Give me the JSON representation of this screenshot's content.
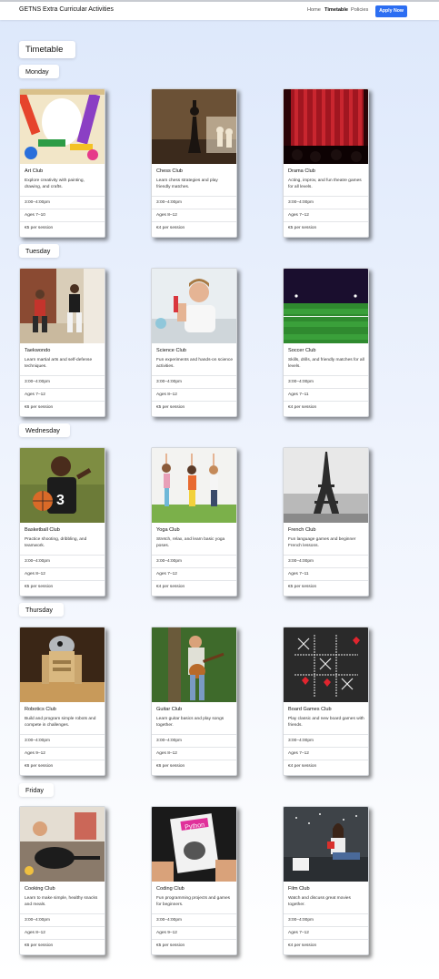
{
  "header": {
    "brand": "GETNS Extra Curricular Activities",
    "nav": [
      {
        "label": "Home",
        "active": false
      },
      {
        "label": "Timetable",
        "active": true
      },
      {
        "label": "Policies",
        "active": false
      }
    ],
    "apply_label": "Apply Now",
    "accent": "#2c6ef2"
  },
  "page_title": "Timetable",
  "days": [
    {
      "name": "Monday",
      "clubs": [
        {
          "name": "Art Club",
          "desc": "Explore creativity with painting, drawing, and crafts.",
          "time": "3:00–4:00pm",
          "ages": "Ages 7–10",
          "price": "€5 per session",
          "image": "art-supplies-photo"
        },
        {
          "name": "Chess Club",
          "desc": "Learn chess strategies and play friendly matches.",
          "time": "3:00–4:00pm",
          "ages": "Ages 8–12",
          "price": "€4 per session",
          "image": "chess-pieces-photo"
        },
        {
          "name": "Drama Club",
          "desc": "Acting, improv, and fun theatre games for all levels.",
          "time": "3:00–4:00pm",
          "ages": "Ages 7–12",
          "price": "€5 per session",
          "image": "theatre-curtain-photo"
        }
      ]
    },
    {
      "name": "Tuesday",
      "clubs": [
        {
          "name": "Taekwondo",
          "desc": "Learn martial arts and self-defense techniques.",
          "time": "3:00–4:00pm",
          "ages": "Ages 7–12",
          "price": "€6 per session",
          "image": "taekwondo-kids-photo"
        },
        {
          "name": "Science Club",
          "desc": "Fun experiments and hands-on science activities.",
          "time": "3:00–4:00pm",
          "ages": "Ages 8–12",
          "price": "€5 per session",
          "image": "science-boy-photo"
        },
        {
          "name": "Soccer Club",
          "desc": "Skills, drills, and friendly matches for all levels.",
          "time": "3:00–4:00pm",
          "ages": "Ages 7–11",
          "price": "€4 per session",
          "image": "soccer-pitch-photo"
        }
      ]
    },
    {
      "name": "Wednesday",
      "clubs": [
        {
          "name": "Basketball Club",
          "desc": "Practice shooting, dribbling, and teamwork.",
          "time": "3:00–4:00pm",
          "ages": "Ages 8–12",
          "price": "€5 per session",
          "image": "basketball-boy-photo"
        },
        {
          "name": "Yoga Club",
          "desc": "Stretch, relax, and learn basic yoga poses.",
          "time": "3:00–4:00pm",
          "ages": "Ages 7–12",
          "price": "€4 per session",
          "image": "yoga-kids-photo"
        },
        {
          "name": "French Club",
          "desc": "Fun language games and beginner French lessons.",
          "time": "3:00–4:00pm",
          "ages": "Ages 7–11",
          "price": "€5 per session",
          "image": "eiffel-tower-photo"
        }
      ]
    },
    {
      "name": "Thursday",
      "clubs": [
        {
          "name": "Robotics Club",
          "desc": "Build and program simple robots and compete in challenges.",
          "time": "3:00–4:00pm",
          "ages": "Ages 9–12",
          "price": "€6 per session",
          "image": "robot-toy-photo"
        },
        {
          "name": "Guitar Club",
          "desc": "Learn guitar basics and play songs together.",
          "time": "3:00–4:00pm",
          "ages": "Ages 8–12",
          "price": "€6 per session",
          "image": "guitar-boy-photo"
        },
        {
          "name": "Board Games Club",
          "desc": "Play classic and new board games with friends.",
          "time": "3:00–4:00pm",
          "ages": "Ages 7–12",
          "price": "€4 per session",
          "image": "tic-tac-toe-photo"
        }
      ]
    },
    {
      "name": "Friday",
      "clubs": [
        {
          "name": "Cooking Club",
          "desc": "Learn to make simple, healthy snacks and meals.",
          "time": "3:00–4:00pm",
          "ages": "Ages 8–12",
          "price": "€6 per session",
          "image": "cooking-pan-photo"
        },
        {
          "name": "Coding Club",
          "desc": "Fun programming projects and games for beginners.",
          "time": "3:00–4:00pm",
          "ages": "Ages 9–12",
          "price": "€5 per session",
          "image": "python-book-photo"
        },
        {
          "name": "Film Club",
          "desc": "Watch and discuss great movies together.",
          "time": "3:00–4:00pm",
          "ages": "Ages 7–12",
          "price": "€4 per session",
          "image": "film-girl-photo"
        }
      ]
    }
  ]
}
